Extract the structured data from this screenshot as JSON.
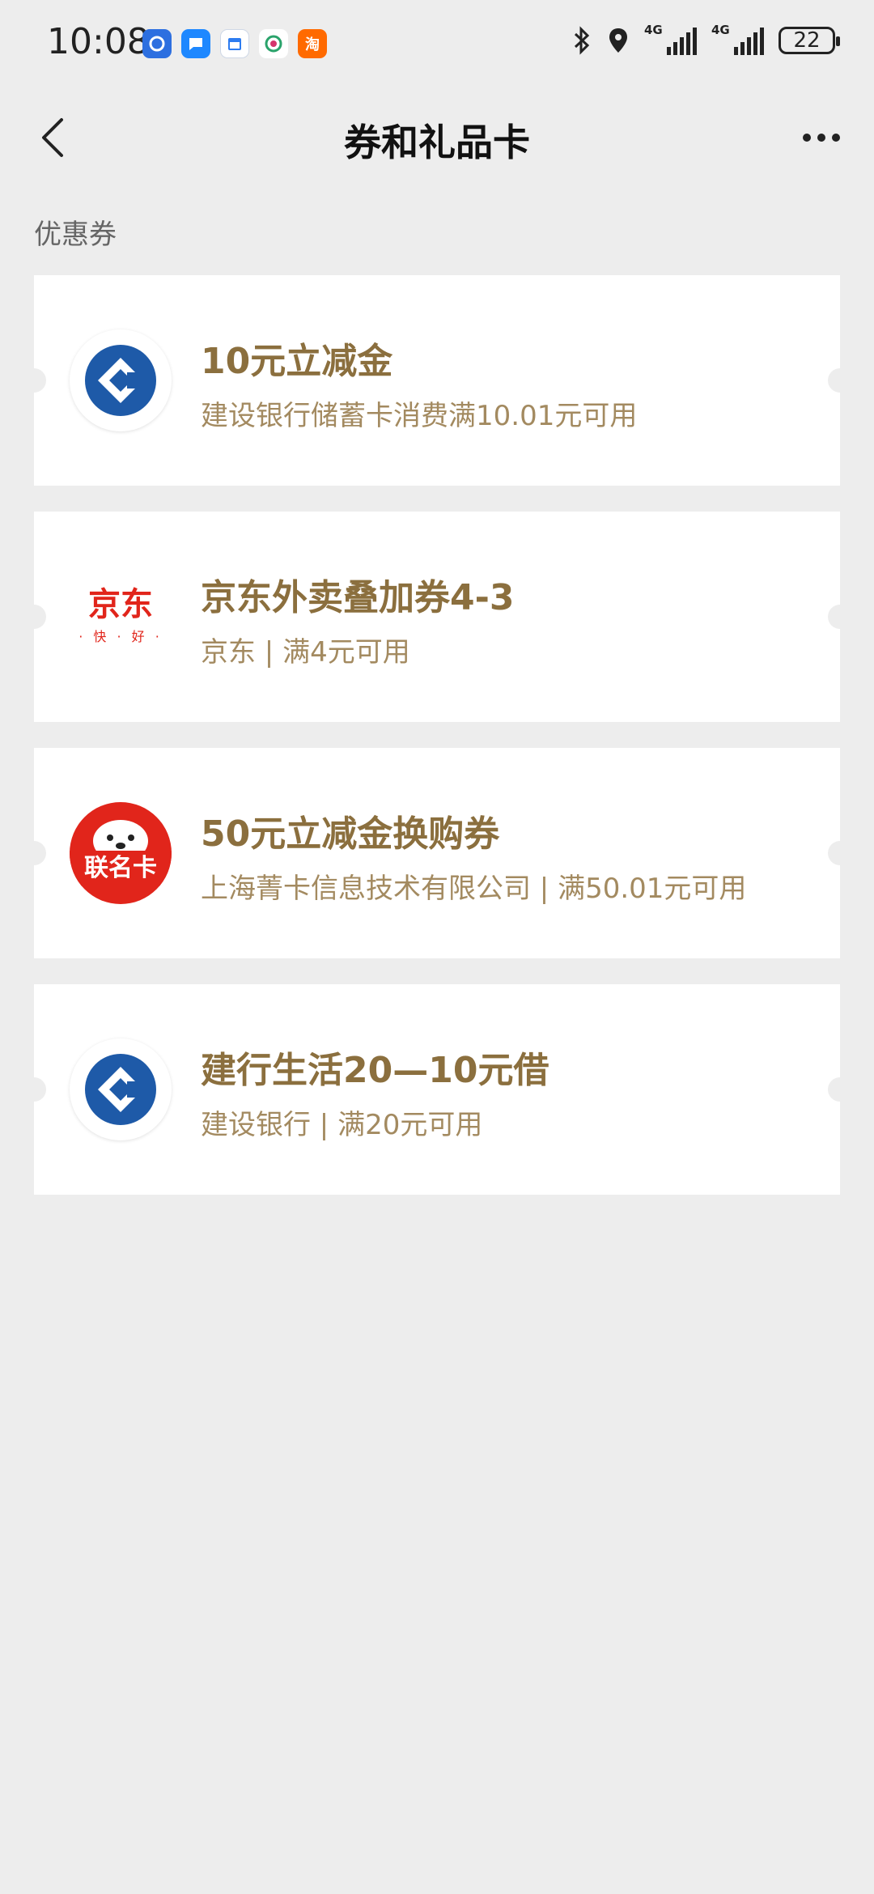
{
  "status_bar": {
    "time": "10:08",
    "network1": "4G",
    "network2": "4G",
    "battery": "22",
    "app_icons": [
      "app-blue-icon",
      "message-icon",
      "calendar-icon",
      "mobile-icon",
      "taobao-icon"
    ],
    "taobao_label": "淘"
  },
  "header": {
    "title": "券和礼品卡"
  },
  "section": {
    "label": "优惠券"
  },
  "coupons": [
    {
      "logo": "ccb-logo-icon",
      "title": "10元立减金",
      "desc": "建设银行储蓄卡消费满10.01元可用"
    },
    {
      "logo": "jd-logo-icon",
      "title": "京东外卖叠加券4-3",
      "desc": "京东 | 满4元可用",
      "logo_text": "京东",
      "logo_sub": "· 快 · 好 ·"
    },
    {
      "logo": "joint-card-logo-icon",
      "title": "50元立减金换购券",
      "desc": "上海菁卡信息技术有限公司 | 满50.01元可用",
      "logo_badge": "联名卡"
    },
    {
      "logo": "ccb-logo-icon",
      "title": "建行生活20—10元借",
      "desc": "建设银行 | 满20元可用"
    }
  ],
  "colors": {
    "background": "#ededed",
    "title_gold": "#8b6f3e",
    "desc_gold": "#a38a60",
    "ccb_blue": "#1e5aa8",
    "jd_red": "#e1251b"
  }
}
